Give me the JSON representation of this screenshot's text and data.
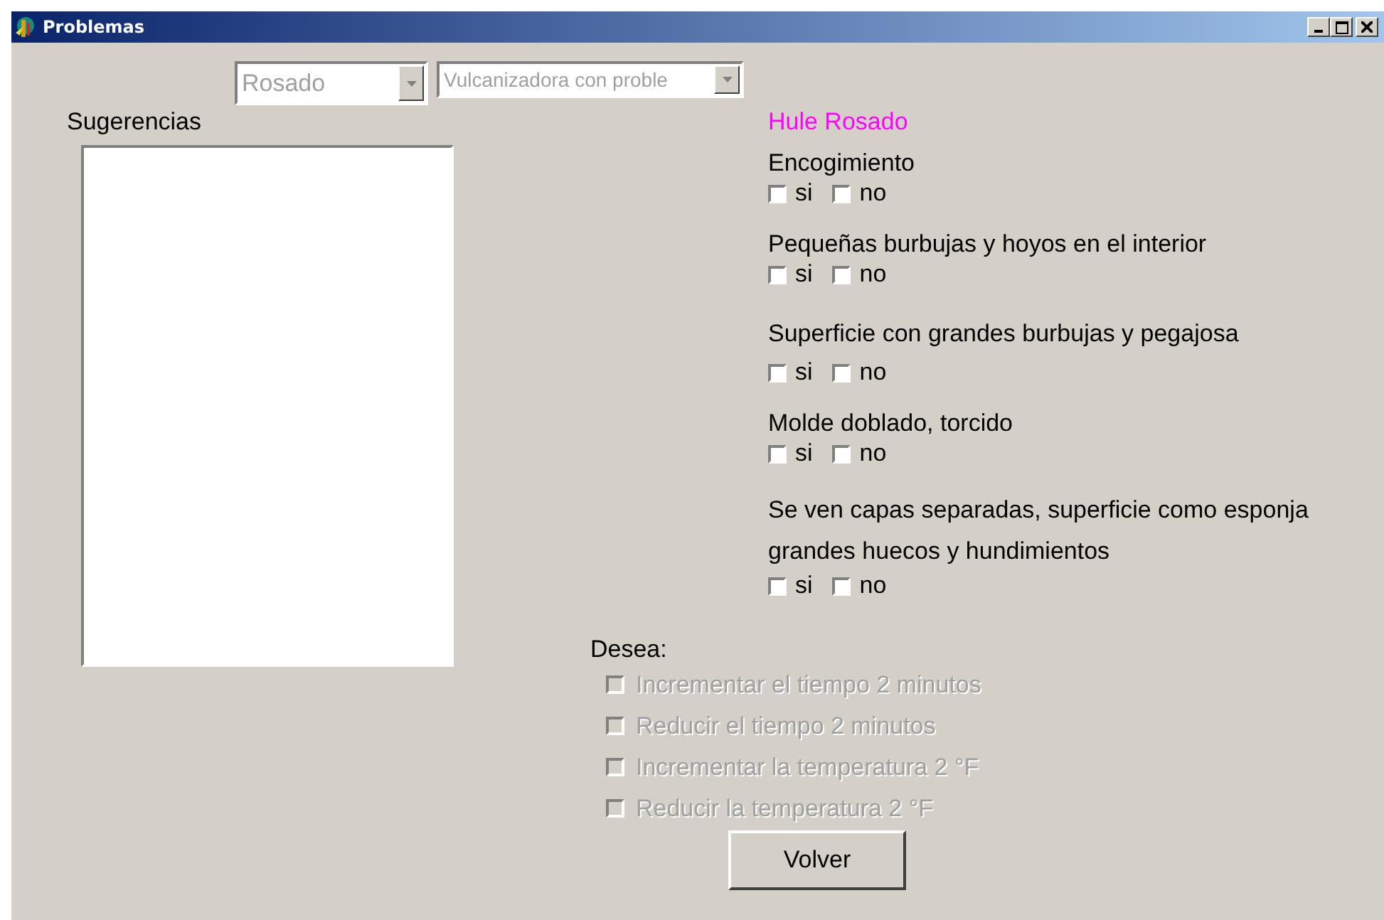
{
  "window": {
    "title": "Problemas"
  },
  "combos": [
    {
      "value": "Rosado",
      "disabled": true
    },
    {
      "value": "Vulcanizadora con proble",
      "disabled": true
    }
  ],
  "suggestions": {
    "label": "Sugerencias"
  },
  "rubber": {
    "title": "Hule Rosado"
  },
  "questions": [
    {
      "label": "Encogimiento",
      "options": [
        {
          "label": "si",
          "checked": false
        },
        {
          "label": "no",
          "checked": false
        }
      ]
    },
    {
      "label": "Pequeñas burbujas y hoyos en el interior",
      "options": [
        {
          "label": "si",
          "checked": false
        },
        {
          "label": "no",
          "checked": false
        }
      ]
    },
    {
      "label": "Superficie con grandes burbujas y pegajosa",
      "options": [
        {
          "label": "si",
          "checked": false
        },
        {
          "label": "no",
          "checked": false
        }
      ]
    },
    {
      "label": "Molde doblado, torcido",
      "options": [
        {
          "label": "si",
          "checked": false
        },
        {
          "label": "no",
          "checked": false
        }
      ]
    },
    {
      "label": "Se ven capas separadas, superficie como esponja grandes huecos y hundimientos",
      "options": [
        {
          "label": "si",
          "checked": false
        },
        {
          "label": "no",
          "checked": false
        }
      ]
    }
  ],
  "actions": {
    "label": "Desea:",
    "options": [
      {
        "label": "Incrementar el tiempo 2 minutos",
        "checked": false,
        "disabled": true
      },
      {
        "label": "Reducir el tiempo 2 minutos",
        "checked": false,
        "disabled": true
      },
      {
        "label": "Incrementar la temperatura 2 °F",
        "checked": false,
        "disabled": true
      },
      {
        "label": "Reducir la temperatura 2 °F",
        "checked": false,
        "disabled": true
      }
    ]
  },
  "buttons": [
    "Volver"
  ]
}
